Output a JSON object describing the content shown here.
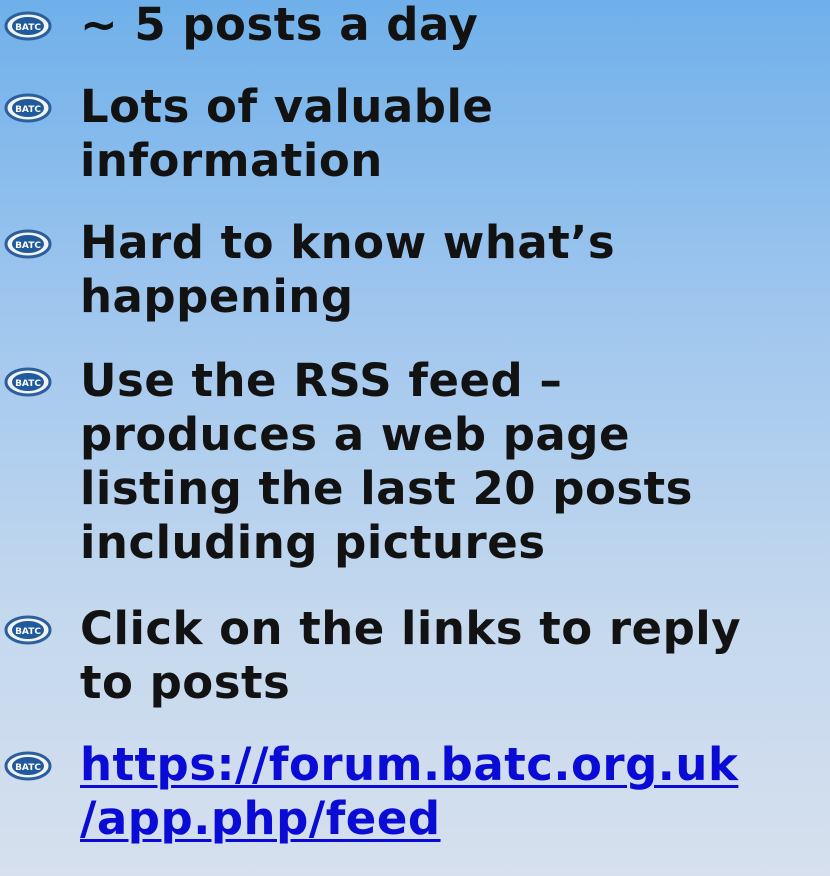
{
  "slide": {
    "icon_name": "batc-logo-icon",
    "icon_text": "BATC",
    "bullets": [
      {
        "text": "~ 5 posts a day"
      },
      {
        "text": "Lots of valuable\ninformation"
      },
      {
        "text": "Hard to know what’s\nhappening"
      },
      {
        "text": "Use the RSS feed –\nproduces a web page\nlisting the last 20 posts\nincluding pictures"
      },
      {
        "text": "Click on the links to reply\nto posts"
      },
      {
        "text": "https://forum.batc.org.uk\n/app.php/feed"
      }
    ],
    "link_color": "#0b0bd6"
  }
}
